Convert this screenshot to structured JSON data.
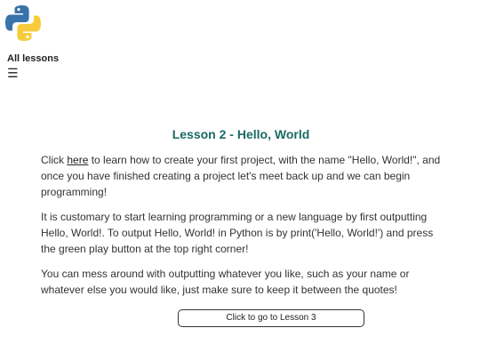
{
  "brand": {
    "logo_icon": "python-logo-icon",
    "colors": {
      "python_blue": "#3873a9",
      "python_yellow": "#f7cc3c",
      "title_teal": "#1a6a66"
    }
  },
  "nav": {
    "all_lessons_label": "All lessons",
    "menu_icon": "☰"
  },
  "lesson": {
    "title": "Lesson 2 - Hello, World",
    "p1_before_link": "Click ",
    "p1_link": "here",
    "p1_after_link": " to learn how to create your first project, with the name \"Hello, World!\", and once you have finished creating a project let's meet back up and we can begin programming!",
    "p2": "It is customary to start learning programming or a new language by first outputting Hello, World!. To output Hello, World! in Python is by print('Hello, World!') and press the green play button at the top right corner!",
    "p3": "You can mess around with outputting whatever you like, such as your name or whatever else you would like, just make sure to keep it between the quotes!"
  },
  "next_button_label": "Click to go to Lesson 3"
}
